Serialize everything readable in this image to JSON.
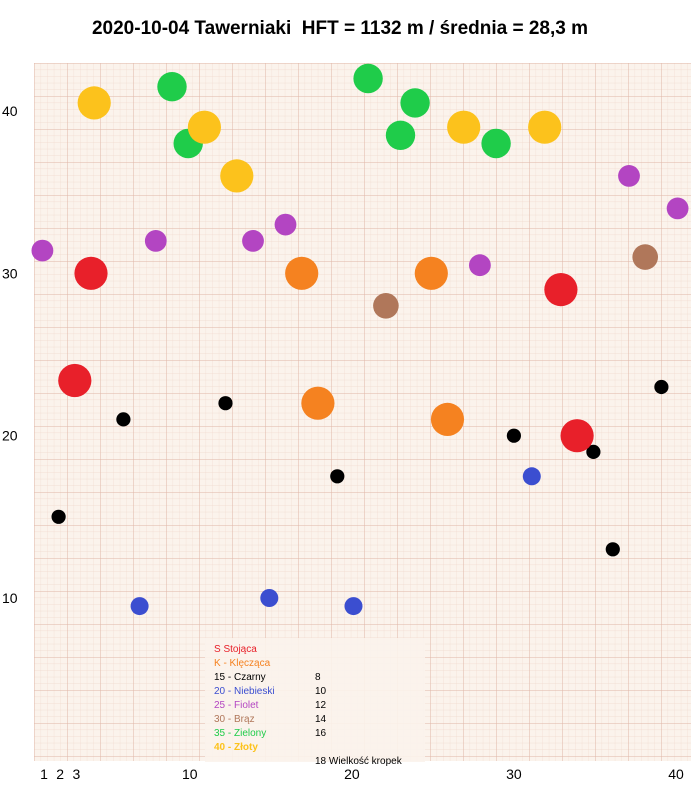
{
  "title": "2020-10-04 Tawerniaki  HFT = 1132 m / średnia = 28,3 m",
  "colors": {
    "stojaca": "#e8202a",
    "kleczaca": "#f58220",
    "czarny": "#000000",
    "niebieski": "#3b4ed0",
    "fiolet": "#b345c2",
    "braz": "#b0775a",
    "zielony": "#1fcc4a",
    "zloty": "#fcc21c",
    "paper": "#fbf3ec",
    "grid_minor": "#efd7cc",
    "grid_major": "#dfb6a6"
  },
  "chart_data": {
    "type": "scatter",
    "title": "2020-10-04 Tawerniaki  HFT = 1132 m / średnia = 28,3 m",
    "xlabel": "",
    "ylabel": "",
    "xlim": [
      0.5,
      40.5
    ],
    "ylim": [
      1,
      42.5
    ],
    "x_ticks": [
      {
        "v": 1,
        "label": "1"
      },
      {
        "v": 2,
        "label": "2"
      },
      {
        "v": 3,
        "label": "3"
      },
      {
        "v": 10,
        "label": "10"
      },
      {
        "v": 20,
        "label": "20"
      },
      {
        "v": 30,
        "label": "30"
      },
      {
        "v": 40,
        "label": "40"
      }
    ],
    "y_ticks": [
      {
        "v": 10,
        "label": "10"
      },
      {
        "v": 20,
        "label": "20"
      },
      {
        "v": 30,
        "label": "30"
      },
      {
        "v": 40,
        "label": "40"
      }
    ],
    "grid": true,
    "points": [
      {
        "x": 1.9,
        "y": 15,
        "color": "czarny",
        "size": 8
      },
      {
        "x": 5.9,
        "y": 21,
        "color": "czarny",
        "size": 8
      },
      {
        "x": 12.2,
        "y": 22,
        "color": "czarny",
        "size": 8
      },
      {
        "x": 19.1,
        "y": 17.5,
        "color": "czarny",
        "size": 8
      },
      {
        "x": 30,
        "y": 20,
        "color": "czarny",
        "size": 8
      },
      {
        "x": 34.9,
        "y": 19,
        "color": "czarny",
        "size": 8
      },
      {
        "x": 36.1,
        "y": 13,
        "color": "czarny",
        "size": 8
      },
      {
        "x": 39.1,
        "y": 23,
        "color": "czarny",
        "size": 8
      },
      {
        "x": 6.9,
        "y": 9.5,
        "color": "niebieski",
        "size": 10
      },
      {
        "x": 14.9,
        "y": 10,
        "color": "niebieski",
        "size": 10
      },
      {
        "x": 20.1,
        "y": 9.5,
        "color": "niebieski",
        "size": 10
      },
      {
        "x": 31.1,
        "y": 17.5,
        "color": "niebieski",
        "size": 10
      },
      {
        "x": 0.9,
        "y": 31.4,
        "color": "fiolet",
        "size": 12
      },
      {
        "x": 7.9,
        "y": 32,
        "color": "fiolet",
        "size": 12
      },
      {
        "x": 13.9,
        "y": 32,
        "color": "fiolet",
        "size": 12
      },
      {
        "x": 15.9,
        "y": 33,
        "color": "fiolet",
        "size": 12
      },
      {
        "x": 27.9,
        "y": 30.5,
        "color": "fiolet",
        "size": 12
      },
      {
        "x": 37.1,
        "y": 36,
        "color": "fiolet",
        "size": 12
      },
      {
        "x": 40.1,
        "y": 34,
        "color": "fiolet",
        "size": 12
      },
      {
        "x": 22.1,
        "y": 28,
        "color": "braz",
        "size": 14
      },
      {
        "x": 38.1,
        "y": 31,
        "color": "braz",
        "size": 14
      },
      {
        "x": 8.9,
        "y": 41.5,
        "color": "zielony",
        "size": 16
      },
      {
        "x": 9.9,
        "y": 38,
        "color": "zielony",
        "size": 16
      },
      {
        "x": 21,
        "y": 42,
        "color": "zielony",
        "size": 16
      },
      {
        "x": 23,
        "y": 38.5,
        "color": "zielony",
        "size": 16
      },
      {
        "x": 23.9,
        "y": 40.5,
        "color": "zielony",
        "size": 16
      },
      {
        "x": 28.9,
        "y": 38,
        "color": "zielony",
        "size": 16
      },
      {
        "x": 4.1,
        "y": 40.5,
        "color": "zloty",
        "size": 18
      },
      {
        "x": 10.9,
        "y": 39,
        "color": "zloty",
        "size": 18
      },
      {
        "x": 12.9,
        "y": 36,
        "color": "zloty",
        "size": 18
      },
      {
        "x": 26.9,
        "y": 39,
        "color": "zloty",
        "size": 18
      },
      {
        "x": 31.9,
        "y": 39,
        "color": "zloty",
        "size": 18
      },
      {
        "x": 2.9,
        "y": 23.4,
        "color": "stojaca",
        "size": 18
      },
      {
        "x": 3.9,
        "y": 30,
        "color": "stojaca",
        "size": 18
      },
      {
        "x": 32.9,
        "y": 29,
        "color": "stojaca",
        "size": 18
      },
      {
        "x": 33.9,
        "y": 20,
        "color": "stojaca",
        "size": 18
      },
      {
        "x": 16.9,
        "y": 30,
        "color": "kleczaca",
        "size": 18
      },
      {
        "x": 17.9,
        "y": 22,
        "color": "kleczaca",
        "size": 18
      },
      {
        "x": 24.9,
        "y": 30,
        "color": "kleczaca",
        "size": 18
      },
      {
        "x": 25.9,
        "y": 21,
        "color": "kleczaca",
        "size": 18
      }
    ],
    "legend": {
      "position": "bottom-center",
      "items": [
        {
          "label": "S     Stojąca",
          "value": "",
          "color": "stojaca"
        },
        {
          "label": "K  - Klęcząca",
          "value": "",
          "color": "kleczaca"
        },
        {
          "label": "15 - Czarny",
          "value": "8",
          "color": "czarny"
        },
        {
          "label": "20 - Niebieski",
          "value": "10",
          "color": "niebieski"
        },
        {
          "label": "25 - Fiolet",
          "value": "12",
          "color": "fiolet"
        },
        {
          "label": "30 - Brąz",
          "value": "14",
          "color": "braz"
        },
        {
          "label": "35 - Zielony",
          "value": "16",
          "color": "zielony"
        },
        {
          "label": "40 - Złoty",
          "value": "",
          "color": "zloty",
          "bold": true
        },
        {
          "label": "",
          "value": "18 Wielkość kropek",
          "color": "czarny"
        }
      ]
    }
  }
}
